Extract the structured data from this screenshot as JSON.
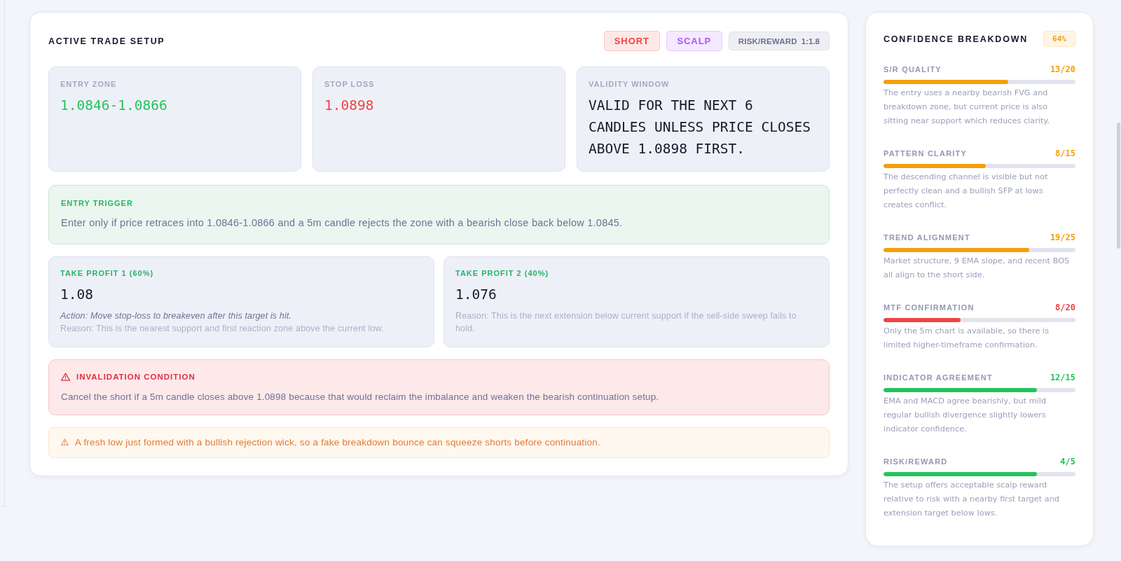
{
  "trade_setup": {
    "title": "ACTIVE TRADE SETUP",
    "badges": [
      {
        "kind": "tag",
        "label": "SHORT",
        "color": "#ef4444"
      },
      {
        "kind": "tag",
        "label": "SCALP",
        "color": "#a855f7"
      },
      {
        "kind": "ratio",
        "label": "RISK/REWARD",
        "value": "1:1.8",
        "color": "#6b7194"
      }
    ],
    "metrics": [
      {
        "label": "ENTRY ZONE",
        "value": "1.0846-1.0866",
        "color": "#22c55e"
      },
      {
        "label": "STOP LOSS",
        "value": "1.0898",
        "color": "#ef4444"
      },
      {
        "label": "VALIDITY WINDOW",
        "value": "VALID FOR THE NEXT 6 CANDLES UNLESS PRICE CLOSES ABOVE 1.0898 FIRST.",
        "color": "#141828"
      }
    ],
    "entry_trigger": {
      "label": "ENTRY TRIGGER",
      "text": "Enter only if price retraces into 1.0846-1.0866 and a 5m candle rejects the zone with a bearish close back below 1.0845."
    },
    "take_profits": [
      {
        "label": "TAKE PROFIT 1 (60%)",
        "value": "1.08",
        "action": "Action: Move stop-loss to breakeven after this target is hit.",
        "reason": "Reason: This is the nearest support and first reaction zone above the current low."
      },
      {
        "label": "TAKE PROFIT 2 (40%)",
        "value": "1.076",
        "reason": "Reason: This is the next extension below current support if the sell-side sweep fails to hold."
      }
    ],
    "invalidation": {
      "title": "INVALIDATION CONDITION",
      "text": "Cancel the short if a 5m candle closes above 1.0898 because that would reclaim the imbalance and weaken the bearish continuation setup."
    },
    "warning": {
      "text": "A fresh low just formed with a bullish rejection wick, so a fake breakdown bounce can squeeze shorts before continuation."
    }
  },
  "confidence": {
    "title": "CONFIDENCE BREAKDOWN",
    "score": "64%",
    "color": "#f59e0b",
    "factors": [
      {
        "label": "S/R QUALITY",
        "score": "13/20",
        "level": 0.65,
        "color": "#f59e0b",
        "description": "The entry uses a nearby bearish FVG and breakdown zone, but current price is also sitting near support which reduces clarity."
      },
      {
        "label": "PATTERN CLARITY",
        "score": "8/15",
        "level": 0.533,
        "color": "#f59e0b",
        "description": "The descending channel is visible but not perfectly clean and a bullish SFP at lows creates conflict."
      },
      {
        "label": "TREND ALIGNMENT",
        "score": "19/25",
        "level": 0.76,
        "color": "#f59e0b",
        "description": "Market structure, 9 EMA slope, and recent BOS all align to the short side."
      },
      {
        "label": "MTF CONFIRMATION",
        "score": "8/20",
        "level": 0.4,
        "color": "#ef4444",
        "description": "Only the 5m chart is available, so there is limited higher-timeframe confirmation."
      },
      {
        "label": "INDICATOR AGREEMENT",
        "score": "12/15",
        "level": 0.8,
        "color": "#22c55e",
        "description": "EMA and MACD agree bearishly, but mild regular bullish divergence slightly lowers indicator confidence."
      },
      {
        "label": "RISK/REWARD",
        "score": "4/5",
        "level": 0.8,
        "color": "#22c55e",
        "description": "The setup offers acceptable scalp reward relative to risk with a nearby first target and extension target below lows."
      }
    ]
  }
}
